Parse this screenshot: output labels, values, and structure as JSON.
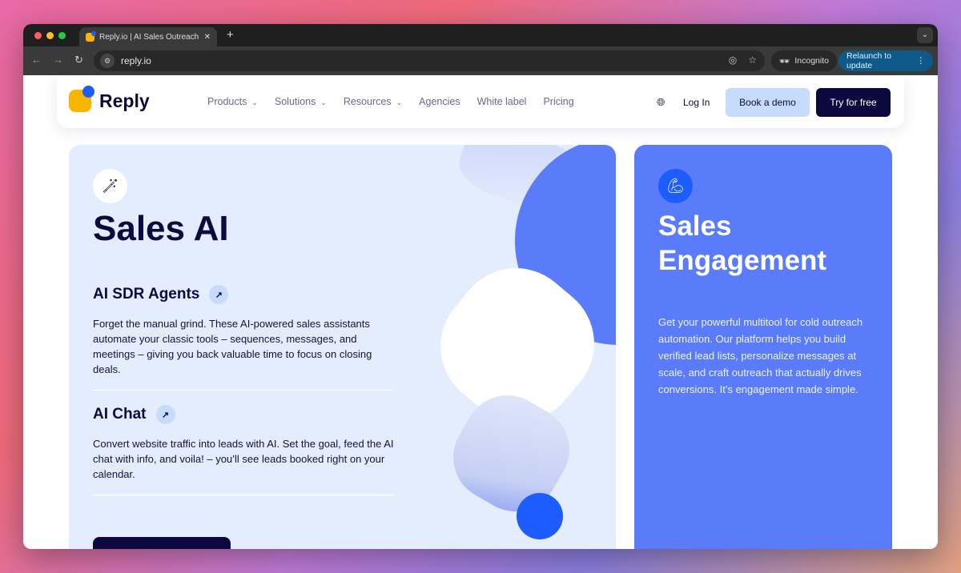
{
  "browser": {
    "tab_title": "Reply.io | AI Sales Outreach &",
    "url": "reply.io",
    "incognito_label": "Incognito",
    "relaunch_label": "Relaunch to update"
  },
  "nav": {
    "brand": "Reply",
    "items": [
      {
        "label": "Products",
        "dropdown": true
      },
      {
        "label": "Solutions",
        "dropdown": true
      },
      {
        "label": "Resources",
        "dropdown": true
      },
      {
        "label": "Agencies"
      },
      {
        "label": "White label"
      },
      {
        "label": "Pricing"
      }
    ],
    "login": "Log In",
    "book_demo": "Book a demo",
    "try_free": "Try for free"
  },
  "sales_ai": {
    "title": "Sales AI",
    "features": [
      {
        "title": "AI SDR Agents",
        "description": "Forget the manual grind.  These AI-powered sales assistants automate your classic tools – sequences, messages, and meetings – giving you back valuable time to focus on closing deals."
      },
      {
        "title": "AI Chat",
        "description": "Convert website traffic into leads with AI. Set the goal, feed the AI chat with info, and voila! – you’ll see leads booked right on your calendar."
      }
    ]
  },
  "sales_engagement": {
    "title_line1": "Sales",
    "title_line2": "Engagement",
    "description": "Get your powerful multitool for cold outreach automation. Our platform helps you build verified lead lists, personalize messages at scale, and craft outreach that actually drives conversions. It’s engagement made simple."
  },
  "colors": {
    "brand_dark": "#0d0840",
    "brand_blue": "#1d5cff",
    "brand_yellow": "#f7b500",
    "engagement_bg": "#5a7cfb",
    "ai_bg": "#e3edfd"
  }
}
